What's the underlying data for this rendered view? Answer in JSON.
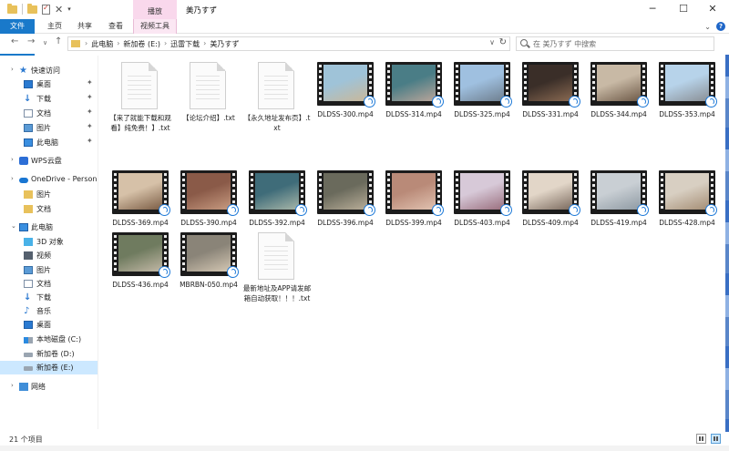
{
  "window": {
    "title": "美乃すず",
    "contextual_tab": "播放",
    "controls": {
      "minimize": "─",
      "maximize": "☐",
      "close": "✕"
    }
  },
  "ribbon": {
    "tabs": [
      "文件",
      "主页",
      "共享",
      "查看",
      "视频工具"
    ],
    "file_color": "#1979ca",
    "manage_color": "#f9d8ec"
  },
  "address": {
    "crumbs": [
      "此电脑",
      "新加卷 (E:)",
      "迅雷下载",
      "美乃すず"
    ],
    "search_placeholder": "在 美乃すず 中搜索"
  },
  "nav": {
    "quick_access": "快速访问",
    "quick_items": [
      "桌面",
      "下载",
      "文档",
      "图片",
      "此电脑"
    ],
    "wps": "WPS云盘",
    "onedrive": "OneDrive - Persona",
    "onedrive_items": [
      "图片",
      "文档"
    ],
    "this_pc": "此电脑",
    "pc_items": [
      "3D 对象",
      "视频",
      "图片",
      "文档",
      "下载",
      "音乐",
      "桌面",
      "本地磁盘 (C:)",
      "新加卷 (D:)",
      "新加卷 (E:)"
    ],
    "network": "网络",
    "selected": "新加卷 (E:)"
  },
  "files": [
    {
      "name": "【来了就能下载和观看】纯免费！】.txt",
      "type": "txt"
    },
    {
      "name": "【论坛介绍】.txt",
      "type": "txt"
    },
    {
      "name": "【永久地址发布页】.txt",
      "type": "txt"
    },
    {
      "name": "DLDSS-300.mp4",
      "type": "mp4"
    },
    {
      "name": "DLDSS-314.mp4",
      "type": "mp4"
    },
    {
      "name": "DLDSS-325.mp4",
      "type": "mp4"
    },
    {
      "name": "DLDSS-331.mp4",
      "type": "mp4"
    },
    {
      "name": "DLDSS-344.mp4",
      "type": "mp4"
    },
    {
      "name": "DLDSS-353.mp4",
      "type": "mp4"
    },
    {
      "name": "DLDSS-369.mp4",
      "type": "mp4"
    },
    {
      "name": "DLDSS-390.mp4",
      "type": "mp4"
    },
    {
      "name": "DLDSS-392.mp4",
      "type": "mp4"
    },
    {
      "name": "DLDSS-396.mp4",
      "type": "mp4"
    },
    {
      "name": "DLDSS-399.mp4",
      "type": "mp4"
    },
    {
      "name": "DLDSS-403.mp4",
      "type": "mp4"
    },
    {
      "name": "DLDSS-409.mp4",
      "type": "mp4"
    },
    {
      "name": "DLDSS-419.mp4",
      "type": "mp4"
    },
    {
      "name": "DLDSS-428.mp4",
      "type": "mp4"
    },
    {
      "name": "DLDSS-436.mp4",
      "type": "mp4"
    },
    {
      "name": "MBRBN-050.mp4",
      "type": "mp4"
    },
    {
      "name": "最新地址及APP请发邮箱自动获取！！！.txt",
      "type": "txt"
    }
  ],
  "thumb_colors": [
    [
      "#9fc3d8",
      "#c9b89a"
    ],
    [
      "#4a7d86",
      "#b9a59a"
    ],
    [
      "#9fc0e0",
      "#6f7f8f"
    ],
    [
      "#3a2e28",
      "#8a6a52"
    ],
    [
      "#c8b9a5",
      "#6e5a48"
    ],
    [
      "#b7d3ea",
      "#8a8f95"
    ],
    [
      "#d6c1a8",
      "#7b5d45"
    ],
    [
      "#8a5a48",
      "#c79a80"
    ],
    [
      "#3f6c79",
      "#a7b6a8"
    ],
    [
      "#6a6a5c",
      "#b8ad98"
    ],
    [
      "#b98a78",
      "#e1c2b0"
    ],
    [
      "#d7c9d8",
      "#9a6f7e"
    ],
    [
      "#e2d6c8",
      "#7b6a5e"
    ],
    [
      "#c9cfd4",
      "#8f9aa3"
    ],
    [
      "#d8cfc2",
      "#a58e75"
    ],
    [
      "#6f7b5f",
      "#c2b8a6"
    ],
    [
      "#8a8478",
      "#d4c7b3"
    ]
  ],
  "status": {
    "count": "21 个项目"
  }
}
